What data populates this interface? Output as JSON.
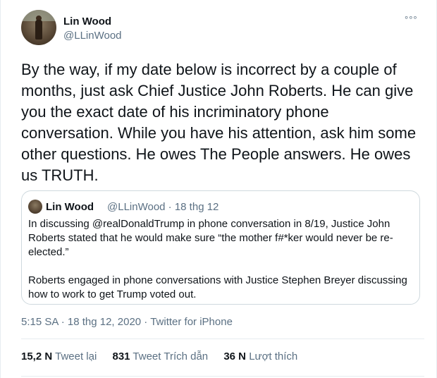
{
  "author": {
    "name": "Lin Wood",
    "handle": "@LLinWood"
  },
  "more_menu": "°°°",
  "tweet": {
    "text": "By the way, if my date below is incorrect by a couple of months, just ask Chief Justice John Roberts. He can give you the exact date of his incriminatory phone conversation. While you have his attention, ask him some other questions. He owes The People answers. He owes us TRUTH."
  },
  "quoted_tweet": {
    "name": "Lin Wood",
    "meta": "@LLinWood · 18 thg 12",
    "paragraph1": "In discussing @realDonaldTrump in phone conversation in 8/19, Justice John Roberts stated that he would make sure “the mother f#*ker would never be re-elected.”",
    "paragraph2": "Roberts engaged in phone conversations with Justice Stephen Breyer discussing how to work to get Trump voted out."
  },
  "timestamp": "5:15 SA · 18 thg 12, 2020 · Twitter for iPhone",
  "stats": {
    "retweets_count": "15,2 N",
    "retweets_label": "Tweet lại",
    "quotes_count": "831",
    "quotes_label": "Tweet Trích dẫn",
    "likes_count": "36 N",
    "likes_label": "Lượt thích"
  }
}
